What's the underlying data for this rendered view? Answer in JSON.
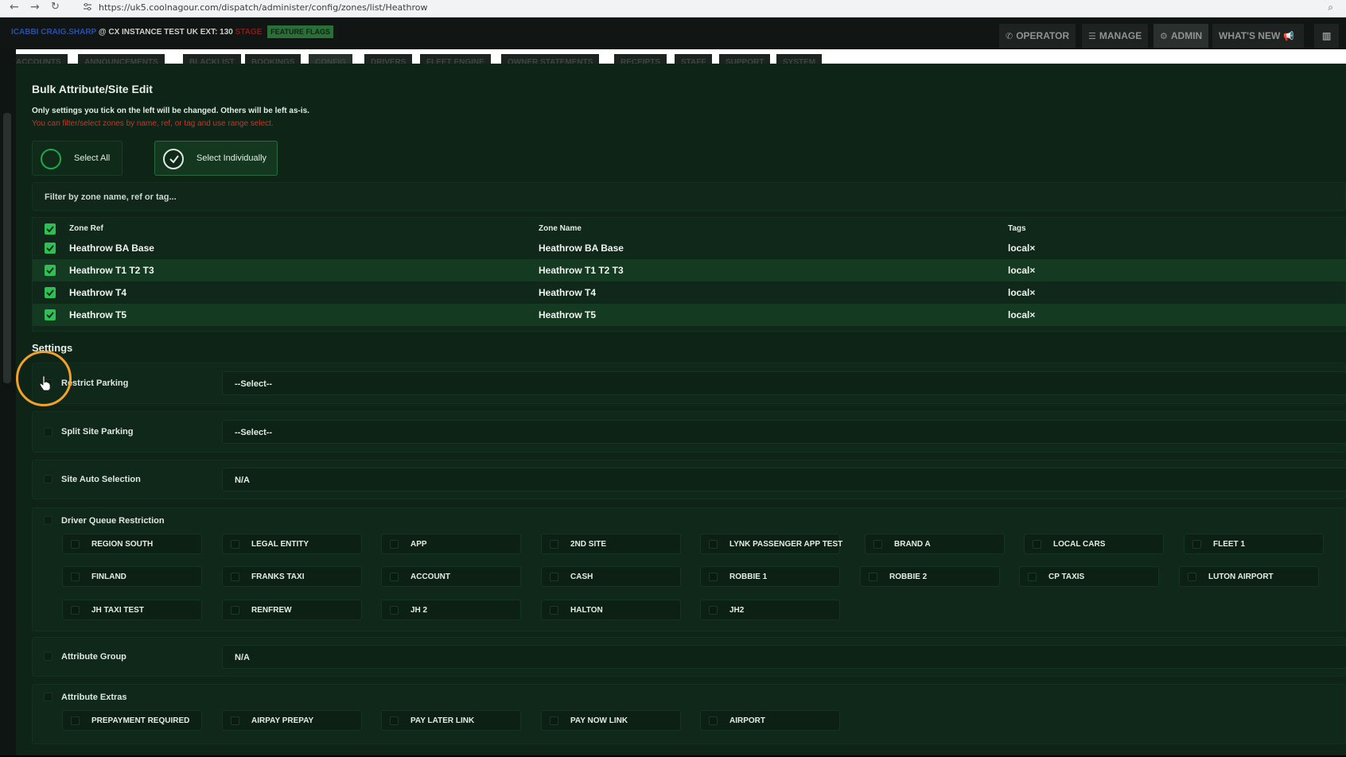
{
  "browser": {
    "url": "https://uk5.coolnagour.com/dispatch/administer/config/zones/list/Heathrow",
    "back_icon": "arrow-left-icon",
    "forward_icon": "arrow-right-icon",
    "reload_icon": "reload-icon"
  },
  "header": {
    "user": "ICABBI CRAIG.SHARP",
    "instance": "@ CX INSTANCE TEST UK EXT: 130",
    "badge": "STAGE",
    "feature_flags": "FEATURE FLAGS",
    "nav": [
      {
        "label": "OPERATOR",
        "icon": "phone-icon",
        "active": false
      },
      {
        "label": "MANAGE",
        "icon": "list-icon",
        "active": false
      },
      {
        "label": "ADMIN",
        "icon": "gear-icon",
        "active": true
      },
      {
        "label": "WHAT'S NEW",
        "icon": "megaphone-icon",
        "active": false
      }
    ],
    "chart_icon": "bar-chart-icon"
  },
  "tabs": [
    {
      "label": "ACCOUNTS",
      "active": false
    },
    {
      "label": "ANNOUNCEMENTS",
      "active": false
    },
    {
      "label": "BLACKLIST",
      "active": false
    },
    {
      "label": "BOOKINGS",
      "active": false
    },
    {
      "label": "CONFIG",
      "active": true
    },
    {
      "label": "DRIVERS",
      "active": false
    },
    {
      "label": "FLEET ENGINE",
      "active": false
    },
    {
      "label": "OWNER STATEMENTS",
      "active": false
    },
    {
      "label": "RECEIPTS",
      "active": false
    },
    {
      "label": "STAFF",
      "active": false
    },
    {
      "label": "SUPPORT",
      "active": false
    },
    {
      "label": "SYSTEM",
      "active": false
    }
  ],
  "panel": {
    "title": "Bulk Attribute/Site Edit",
    "info": "Only settings you tick on the left will be changed. Others will be left as-is.",
    "hint": "You can filter/select zones by name, ref, or tag and use range select.",
    "select_all": "Select All",
    "select_individually": "Select Individually",
    "filter_placeholder": "Filter by zone name, ref or tag..."
  },
  "table": {
    "headers": {
      "ref": "Zone Ref",
      "name": "Zone Name",
      "tags": "Tags"
    },
    "rows": [
      {
        "ref": "Heathrow BA Base",
        "name": "Heathrow BA Base",
        "tags": "local×",
        "checked": true
      },
      {
        "ref": "Heathrow T1 T2 T3",
        "name": "Heathrow T1 T2 T3",
        "tags": "local×",
        "checked": true
      },
      {
        "ref": "Heathrow T4",
        "name": "Heathrow T4",
        "tags": "local×",
        "checked": true
      },
      {
        "ref": "Heathrow T5",
        "name": "Heathrow T5",
        "tags": "local×",
        "checked": true
      }
    ]
  },
  "settings": {
    "title": "Settings",
    "restrict_parking": {
      "label": "Restrict Parking",
      "value": "--Select--"
    },
    "split_site_parking": {
      "label": "Split Site Parking",
      "value": "--Select--"
    },
    "site_auto_selection": {
      "label": "Site Auto Selection",
      "value": "N/A"
    },
    "driver_queue": {
      "label": "Driver Queue Restriction",
      "options": [
        [
          "REGION SOUTH",
          "LEGAL ENTITY",
          "APP",
          "2ND SITE",
          "LYNK PASSENGER APP TEST",
          "BRAND A",
          "LOCAL CARS",
          "FLEET 1"
        ],
        [
          "FINLAND",
          "FRANKS TAXI",
          "ACCOUNT",
          "CASH",
          "ROBBIE 1",
          "ROBBIE 2",
          "CP TAXIS",
          "LUTON AIRPORT"
        ],
        [
          "JH TAXI TEST",
          "RENFREW",
          "JH 2",
          "HALTON",
          "JH2"
        ]
      ]
    },
    "attribute_group": {
      "label": "Attribute Group",
      "value": "N/A"
    },
    "attribute_extras": {
      "label": "Attribute Extras",
      "options": [
        "PREPAYMENT REQUIRED",
        "AIRPAY PREPAY",
        "PAY LATER LINK",
        "PAY NOW LINK",
        "AIRPORT"
      ]
    }
  },
  "colors": {
    "panel_bg": "#0d2416",
    "accent_green": "#2fbf55",
    "hint_red": "#c0392b",
    "cursor_ring": "#f2a12b"
  }
}
